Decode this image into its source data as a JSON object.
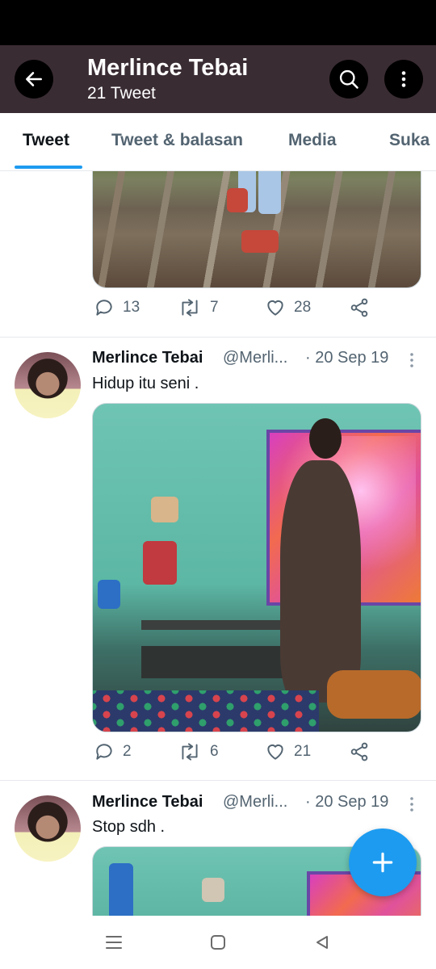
{
  "header": {
    "title": "Merlince Tebai",
    "subtitle": "21 Tweet",
    "back_icon": "arrow-left-icon",
    "search_icon": "search-icon",
    "more_icon": "more-vertical-icon",
    "bg_color": "#3a2c33"
  },
  "tabs": [
    {
      "label": "Tweet",
      "active": true
    },
    {
      "label": "Tweet & balasan",
      "active": false
    },
    {
      "label": "Media",
      "active": false
    },
    {
      "label": "Suka",
      "active": false
    }
  ],
  "accent_color": "#1d9bf0",
  "tweets": [
    {
      "stats": {
        "replies": "13",
        "retweets": "7",
        "likes": "28"
      }
    },
    {
      "name": "Merlince Tebai",
      "handle": "@Merli...",
      "date": "· 20 Sep 19",
      "text": "Hidup itu seni .",
      "stats": {
        "replies": "2",
        "retweets": "6",
        "likes": "21"
      }
    },
    {
      "name": "Merlince Tebai",
      "handle": "@Merli...",
      "date": "· 20 Sep 19",
      "text": "Stop sdh ."
    }
  ],
  "fab": {
    "icon": "plus-icon"
  },
  "navbar": {
    "items": [
      "recent-apps-icon",
      "home-icon",
      "back-triangle-icon"
    ]
  }
}
